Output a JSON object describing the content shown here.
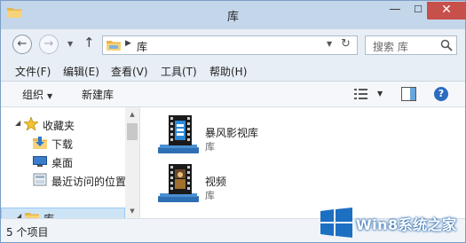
{
  "window": {
    "title": "库",
    "controls": {
      "minimize": "—",
      "maximize": "☐",
      "close": "✕"
    }
  },
  "nav": {
    "back_icon": "back-arrow-icon",
    "forward_icon": "forward-arrow-icon",
    "up_icon": "up-arrow-icon",
    "address_path": "库",
    "search_placeholder": "搜索 库"
  },
  "menu": [
    {
      "label": "文件(F)"
    },
    {
      "label": "编辑(E)"
    },
    {
      "label": "查看(V)"
    },
    {
      "label": "工具(T)"
    },
    {
      "label": "帮助(H)"
    }
  ],
  "toolbar": {
    "organize_label": "组织",
    "new_library_label": "新建库",
    "help_label": "?"
  },
  "nav_pane": {
    "items": [
      {
        "label": "收藏夹",
        "icon": "star-icon"
      },
      {
        "label": "下载",
        "icon": "downloads-folder-icon"
      },
      {
        "label": "桌面",
        "icon": "desktop-icon"
      },
      {
        "label": "最近访问的位置",
        "icon": "recent-places-icon"
      },
      {
        "label": "库",
        "icon": "library-icon"
      }
    ]
  },
  "content": {
    "items": [
      {
        "name": "暴风影视库",
        "type": "库",
        "icon": "video-library-icon"
      },
      {
        "name": "视频",
        "type": "库",
        "icon": "video-library-icon"
      }
    ]
  },
  "status": {
    "text": "5 个项目"
  },
  "watermark": {
    "text": "Win8系统之家"
  },
  "colors": {
    "titlebar": "#c4d6ea",
    "close_button": "#c7504a",
    "selection": "#cde4f7",
    "watermark_blue": "#1d6fc2"
  }
}
